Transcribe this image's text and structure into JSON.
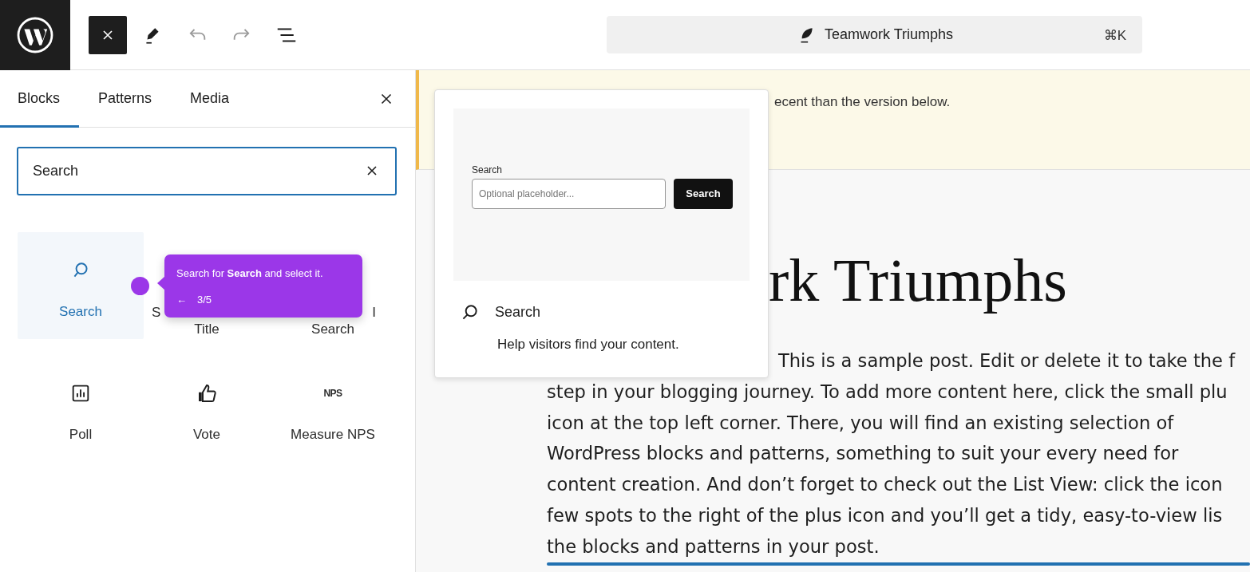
{
  "toolbar": {
    "close_selected": true,
    "undo_disabled": true,
    "redo_disabled": true,
    "command_title": "Teamwork Triumphs",
    "command_shortcut": "⌘K"
  },
  "inserter": {
    "tabs": [
      {
        "label": "Blocks",
        "selected": true
      },
      {
        "label": "Patterns",
        "selected": false
      },
      {
        "label": "Media",
        "selected": false
      }
    ],
    "search": {
      "value": "Search"
    },
    "blocks": [
      {
        "kind": "search",
        "lines": [
          "Search"
        ],
        "selected": true
      },
      {
        "kind": "hidden",
        "lines": [
          "S",
          "Title"
        ],
        "selected": false
      },
      {
        "kind": "hidden",
        "lines": [
          "I",
          "Search"
        ],
        "selected": false
      },
      {
        "kind": "poll",
        "lines": [
          "Poll"
        ],
        "selected": false
      },
      {
        "kind": "vote",
        "lines": [
          "Vote"
        ],
        "selected": false
      },
      {
        "kind": "nps",
        "icon_text": "NPS",
        "lines": [
          "Measure NPS"
        ],
        "selected": false
      }
    ]
  },
  "guide": {
    "text": "Search for **Search** and select it.",
    "back": "←",
    "step": "3/5"
  },
  "preview": {
    "label": "Search",
    "placeholder": "Optional placeholder...",
    "button": "Search",
    "title": "Search",
    "description": "Help visitors find your content."
  },
  "notice": {
    "text": "ecent than the version below."
  },
  "post": {
    "title": "rk Triumphs",
    "lines": [
      "This is a sample post. Edit or delete it to take the f",
      "step in your blogging journey. To add more content here, click the small plu",
      "icon at the top left corner. There, you will find an existing selection of",
      "WordPress blocks and patterns, something to suit your every need for",
      "content creation. And don’t forget to check out the List View: click the icon",
      "few spots to the right of the plus icon and you’ll get a tidy, easy-to-view lis",
      "the blocks and patterns in your post."
    ]
  }
}
